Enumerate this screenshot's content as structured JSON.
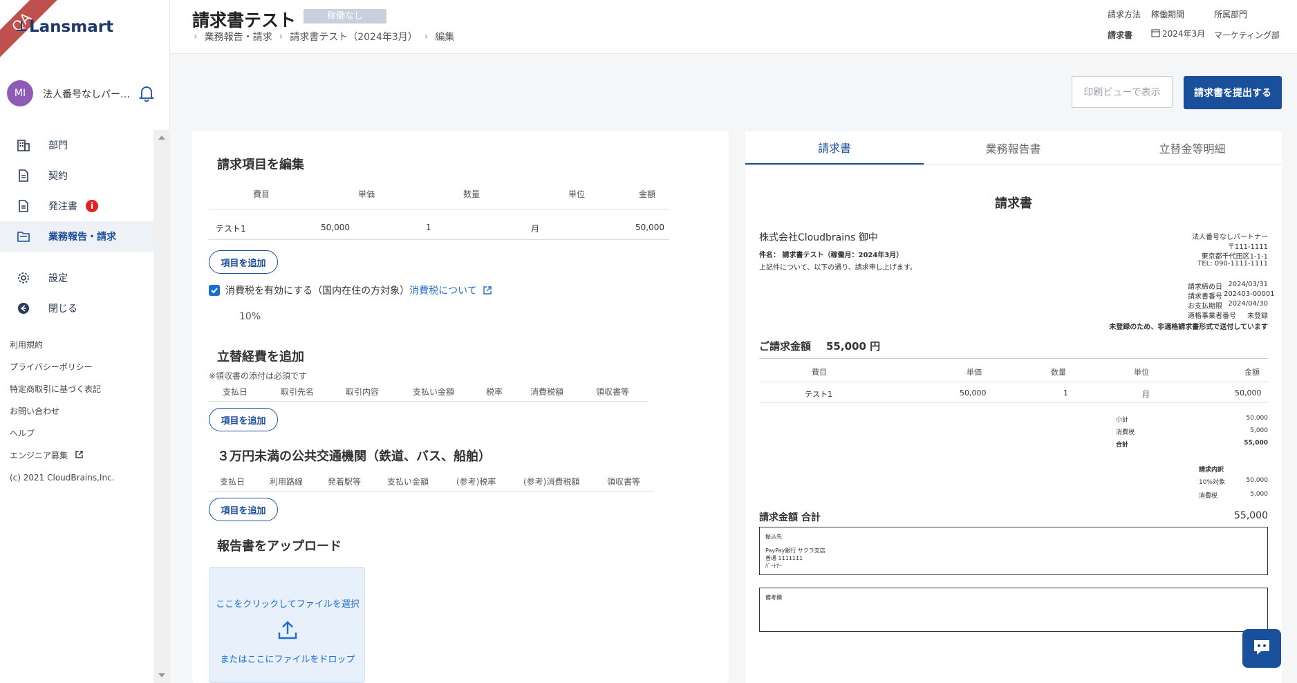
{
  "brand": {
    "ribbon": "QA",
    "logo": "Lansmart"
  },
  "user": {
    "initials": "MI",
    "name": "法人番号なしパー…"
  },
  "nav": [
    {
      "label": "部門",
      "icon": "building-icon"
    },
    {
      "label": "契約",
      "icon": "document-icon"
    },
    {
      "label": "発注書",
      "icon": "document-icon",
      "badge": "i"
    },
    {
      "label": "業務報告・請求",
      "icon": "folder-icon"
    },
    {
      "label": "設定",
      "icon": "gear-icon"
    },
    {
      "label": "閉じる",
      "icon": "arrow-left-circle-icon"
    }
  ],
  "links": [
    "利用規約",
    "プライバシーポリシー",
    "特定商取引に基づく表記",
    "お問い合わせ",
    "ヘルプ",
    "エンジニア募集",
    "(c) 2021 CloudBrains,Inc."
  ],
  "header": {
    "title": "請求書テスト",
    "status": "稼働なし",
    "breadcrumbs": [
      "業務報告・請求",
      "請求書テスト（2024年3月）",
      "編集"
    ],
    "meta_labels": [
      "請求方法",
      "稼働期間",
      "所属部門"
    ],
    "meta_values": [
      "請求書",
      "2024年3月",
      "マーケティング部"
    ]
  },
  "actions": {
    "print": "印刷ビューで表示",
    "submit": "請求書を提出する"
  },
  "edit": {
    "items_title": "請求項目を編集",
    "items_headers": [
      "費目",
      "単価",
      "数量",
      "単位",
      "金額"
    ],
    "items_row": [
      "テスト1",
      "50,000",
      "1",
      "月",
      "50,000"
    ],
    "add_label": "項目を追加",
    "tax_label": "消費税を有効にする（国内在住の方対象）",
    "tax_link": "消費税について",
    "tax_rate": "10%",
    "expense_title": "立替経費を追加",
    "expense_note": "※領収書の添付は必須です",
    "expense_headers": [
      "支払日",
      "取引先名",
      "取引内容",
      "支払い金額",
      "税率",
      "消費税額",
      "領収書等"
    ],
    "transit_title": "３万円未満の公共交通機関（鉄道、バス、船舶）",
    "transit_headers": [
      "支払日",
      "利用路線",
      "発着駅等",
      "支払い金額",
      "(参考)税率",
      "(参考)消費税額",
      "領収書等"
    ],
    "upload_title": "報告書をアップロード",
    "upload_click": "ここをクリックしてファイルを選択",
    "upload_drop": "またはここにファイルをドロップ"
  },
  "preview": {
    "tabs": [
      "請求書",
      "業務報告書",
      "立替金等明細"
    ],
    "doc_title": "請求書",
    "client": "株式会社Cloudbrains 御中",
    "subject": "件名： 請求書テスト（稼働月：2024年3月）",
    "intro": "上記件について、以下の通り、請求申し上げます。",
    "issuer": [
      "法人番号なしパートナー",
      "〒111-1111",
      "東京都千代田区1-1-1",
      "TEL: 090-1111-1111"
    ],
    "dates_labels": [
      "請求締め日",
      "請求書番号",
      "お支払期限",
      "適格事業者番号"
    ],
    "dates_values": [
      "2024/03/31",
      "202403-00001",
      "2024/04/30",
      "未登録"
    ],
    "notice": "未登録のため、非適格請求書形式で送付しています",
    "total_label": "ご請求金額",
    "total_value": "55,000 円",
    "table_headers": [
      "費目",
      "単価",
      "数量",
      "単位",
      "金額"
    ],
    "table_row": [
      "テスト1",
      "50,000",
      "1",
      "月",
      "50,000"
    ],
    "sum_labels": [
      "小計",
      "消費税",
      "合計"
    ],
    "sum_values": [
      "50,000",
      "5,000",
      "55,000"
    ],
    "breakdown_title": "請求内訳",
    "breakdown_labels": [
      "10%対象",
      "消費税"
    ],
    "breakdown_values": [
      "50,000",
      "5,000"
    ],
    "grand_label": "請求金額 合計",
    "grand_value": "55,000",
    "bank_title": "振込先",
    "bank_lines": [
      "PayPay銀行 サクラ支店",
      "普通 1111111",
      "ﾊﾟｰﾄﾅｰ"
    ],
    "remarks_title": "備考欄"
  },
  "colors": {
    "primary": "#1a4f9c",
    "badge": "#e02424",
    "avatar": "#8e5bb6"
  }
}
